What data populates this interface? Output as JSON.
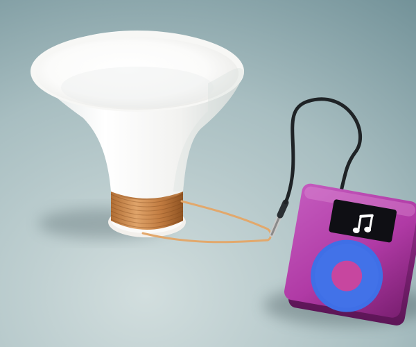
{
  "scene": {
    "screen_icon": "music-note-icon",
    "colors": {
      "background_top": "#6f8f96",
      "background_bottom": "#c9d6d6",
      "cone_outer": "#f4f4f2",
      "cone_inner": "#ffffff",
      "coil_copper": "#c8874a",
      "wire": "#e1a86c",
      "cable": "#1f2326",
      "player_body": "#b23aa6",
      "player_screen": "#0f0f14",
      "click_wheel": "#3f6fe6",
      "click_wheel_center": "#d24aa8",
      "note_glyph": "#ffffff"
    }
  }
}
